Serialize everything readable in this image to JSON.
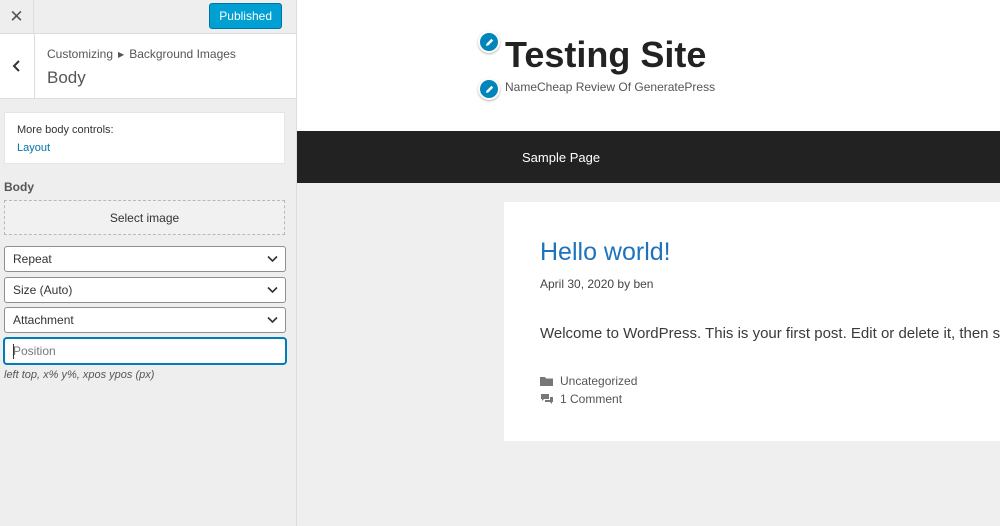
{
  "customizer": {
    "close_icon": "close-icon",
    "publish_label": "Published",
    "breadcrumb_root": "Customizing",
    "breadcrumb_section": "Background Images",
    "section_title": "Body",
    "more_controls_label": "More body controls:",
    "more_controls_link": "Layout",
    "field_label": "Body",
    "select_image_label": "Select image",
    "repeat_value": "Repeat",
    "size_value": "Size (Auto)",
    "attachment_value": "Attachment",
    "position_placeholder": "Position",
    "position_hint": "left top, x% y%, xpos ypos (px)",
    "accent_color": "#00a0d2"
  },
  "site": {
    "title": "Testing Site",
    "tagline": "NameCheap Review Of GeneratePress",
    "nav": [
      "Sample Page"
    ],
    "nav_bg": "#222222",
    "link_color": "#1e73be"
  },
  "post": {
    "title": "Hello world!",
    "date": "April 30, 2020",
    "by": "by",
    "author": "ben",
    "body": "Welcome to WordPress. This is your first post. Edit or delete it, then start writing!",
    "category": "Uncategorized",
    "comments": "1 Comment"
  }
}
